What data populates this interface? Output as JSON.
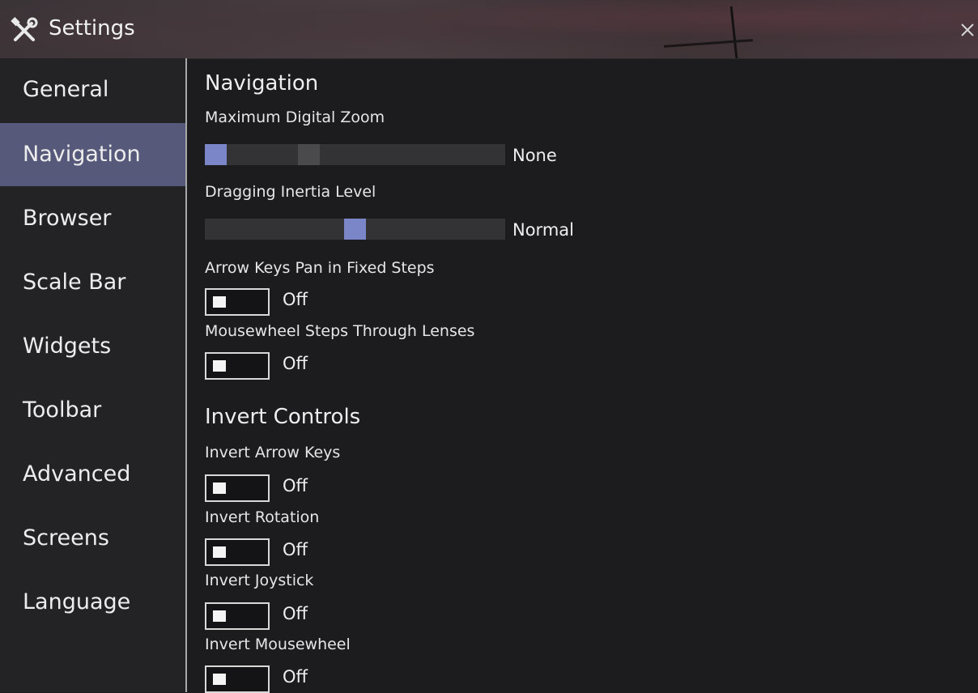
{
  "window": {
    "title": "Settings",
    "icon": "tools-icon",
    "close_icon": "close-icon"
  },
  "sidebar": {
    "items": [
      {
        "label": "General",
        "active": false
      },
      {
        "label": "Navigation",
        "active": true
      },
      {
        "label": "Browser",
        "active": false
      },
      {
        "label": "Scale Bar",
        "active": false
      },
      {
        "label": "Widgets",
        "active": false
      },
      {
        "label": "Toolbar",
        "active": false
      },
      {
        "label": "Advanced",
        "active": false
      },
      {
        "label": "Screens",
        "active": false
      },
      {
        "label": "Language",
        "active": false
      }
    ]
  },
  "navigation": {
    "heading": "Navigation",
    "max_zoom": {
      "label": "Maximum Digital Zoom",
      "value": "None",
      "level": 0.0
    },
    "inertia": {
      "label": "Dragging Inertia Level",
      "value": "Normal",
      "level": 0.5
    },
    "arrow_keys_pan": {
      "label": "Arrow Keys Pan in Fixed Steps",
      "state": "Off"
    },
    "mousewheel_lenses": {
      "label": "Mousewheel Steps Through Lenses",
      "state": "Off"
    }
  },
  "invert": {
    "heading": "Invert Controls",
    "arrow_keys": {
      "label": "Invert Arrow Keys",
      "state": "Off"
    },
    "rotation": {
      "label": "Invert Rotation",
      "state": "Off"
    },
    "joystick": {
      "label": "Invert Joystick",
      "state": "Off"
    },
    "mousewheel": {
      "label": "Invert Mousewheel",
      "state": "Off"
    }
  },
  "colors": {
    "accent": "#7a86c8",
    "active_item": "#56597a",
    "background": "#1c1c1e"
  }
}
